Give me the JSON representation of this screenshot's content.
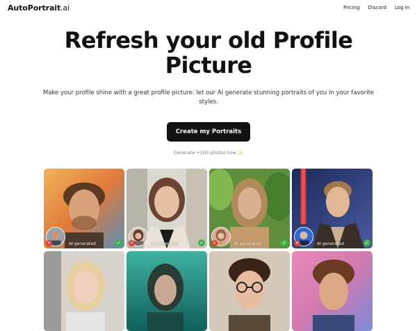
{
  "brand": {
    "name": "AutoPortrait",
    "suffix": ".ai"
  },
  "nav": {
    "links": [
      "Pricing",
      "Discord",
      "Log in"
    ]
  },
  "hero": {
    "title_line1": "Refresh your old Profile",
    "title_line2": "Picture",
    "subtitle": "Make your profile shine with a great profile picture: let our AI generate stunning portraits of you in your favorite styles.",
    "cta_label": "Create my Portraits",
    "generate_note": "Generate +100 photos now",
    "generate_icon": "sparkle-icon"
  },
  "gallery": {
    "ai_label": "AI generated",
    "cards": [
      {
        "style": "painterly-man",
        "accent": "#e8a04a"
      },
      {
        "style": "woman-blazer",
        "accent": "#dcd8cf"
      },
      {
        "style": "jungle-woman",
        "accent": "#7aa84a"
      },
      {
        "style": "jedi-man",
        "accent": "#2a3c78"
      },
      {
        "style": "blonde-woman",
        "accent": "#e6e2dc"
      },
      {
        "style": "underwater-woman",
        "accent": "#1f8f86"
      },
      {
        "style": "glasses-man",
        "accent": "#c9b9a4"
      },
      {
        "style": "painterly-boy",
        "accent": "#d86fa8"
      }
    ]
  },
  "colors": {
    "primary": "#111111",
    "success": "#3cb54a",
    "reject": "#e03c3c"
  }
}
